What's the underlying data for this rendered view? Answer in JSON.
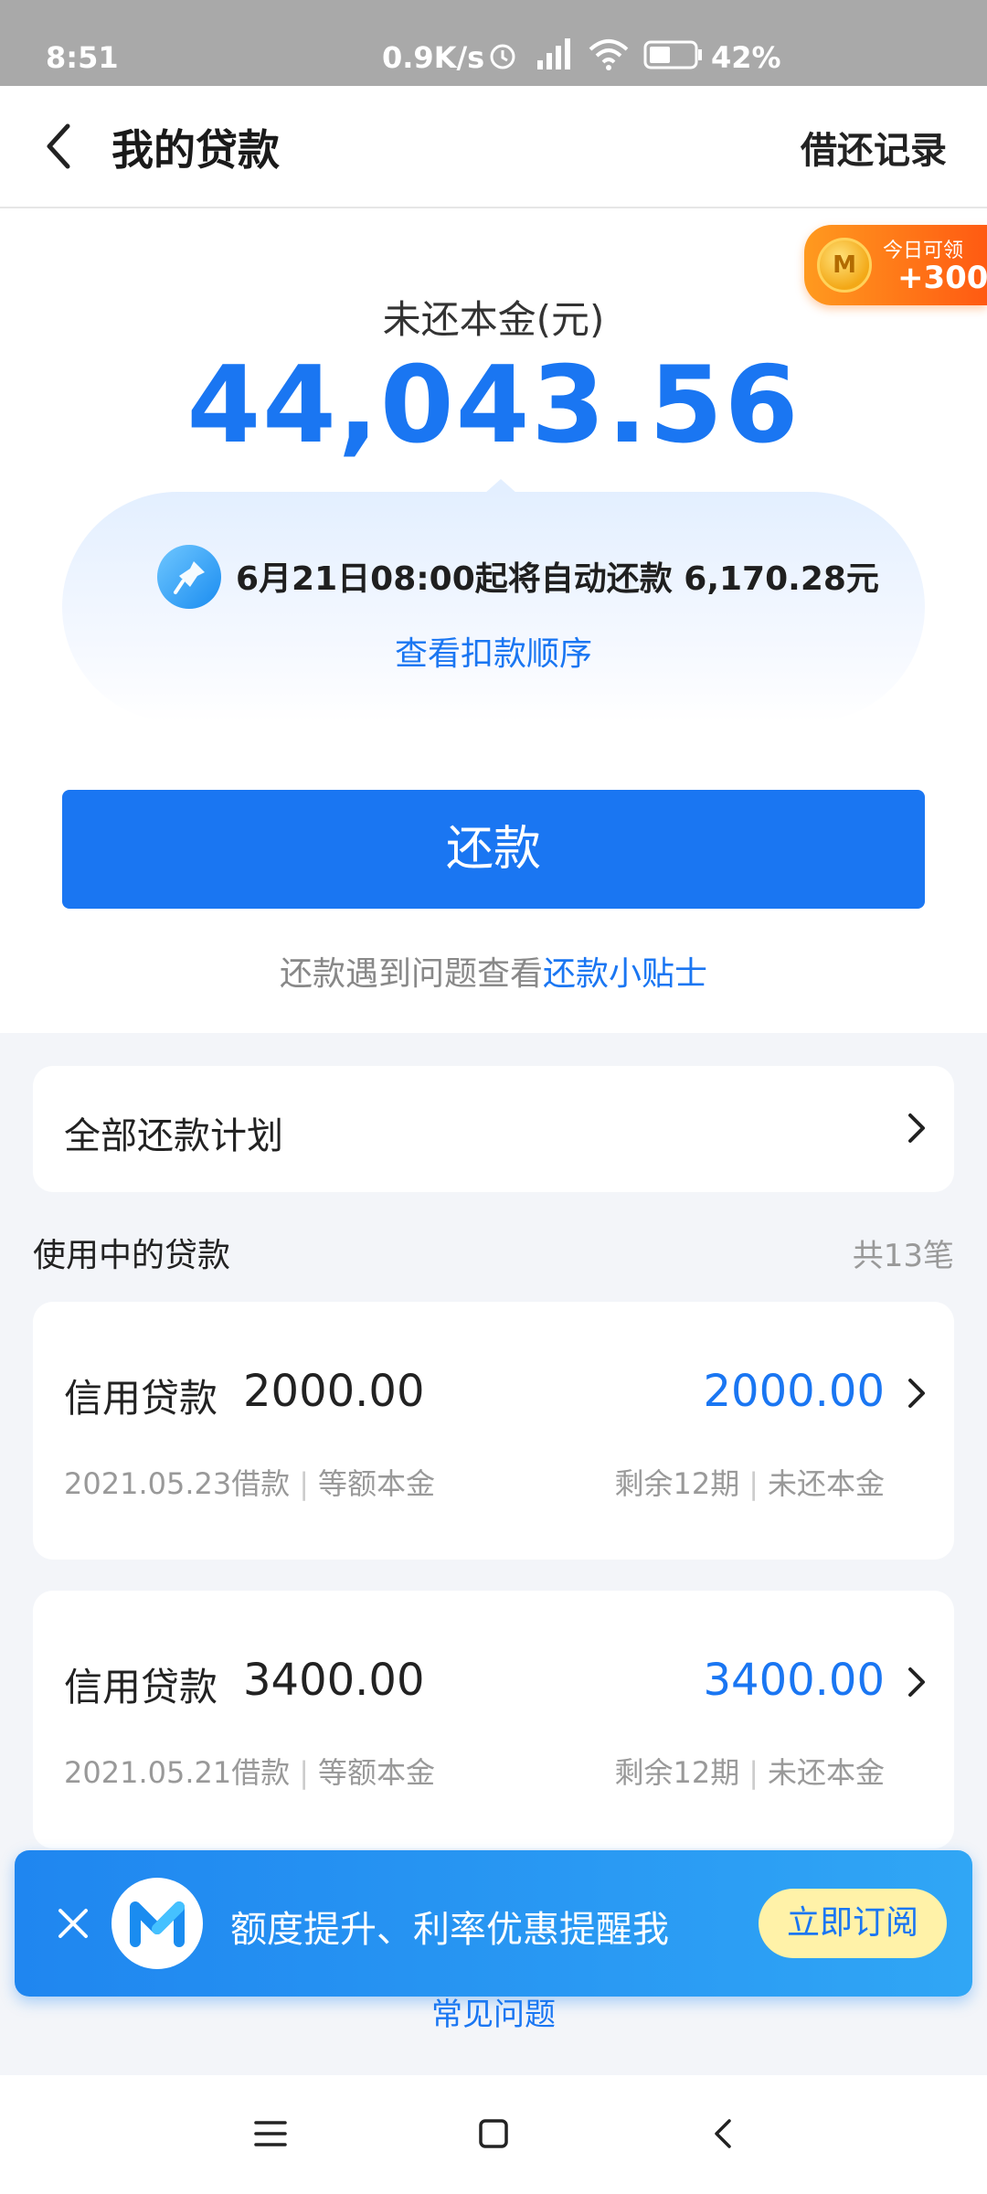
{
  "status_bar": {
    "time": "8:51",
    "net_speed": "0.9K/s",
    "battery": "42%"
  },
  "nav": {
    "title": "我的贷款",
    "right_action": "借还记录"
  },
  "badge": {
    "coin_letter": "M",
    "line1": "今日可领",
    "line2": "+300"
  },
  "summary": {
    "label": "未还本金(元)",
    "amount": "44,043.56"
  },
  "auto_repay": {
    "text": "6月21日08:00起将自动还款 6,170.28元",
    "link": "查看扣款顺序"
  },
  "repay_button": "还款",
  "tips": {
    "prefix": "还款遇到问题查看",
    "link": "还款小贴士"
  },
  "plan": {
    "label": "全部还款计划"
  },
  "active_loans": {
    "title": "使用中的贷款",
    "count": "共13笔",
    "items": [
      {
        "type": "信用贷款",
        "amount": "2000.00",
        "remaining": "2000.00",
        "date": "2021.05.23借款",
        "method": "等额本金",
        "periods": "剩余12期",
        "remaining_label": "未还本金"
      },
      {
        "type": "信用贷款",
        "amount": "3400.00",
        "remaining": "3400.00",
        "date": "2021.05.21借款",
        "method": "等额本金",
        "periods": "剩余12期",
        "remaining_label": "未还本金"
      }
    ]
  },
  "faq": "常见问题",
  "subscribe_banner": {
    "text": "额度提升、利率优惠提醒我",
    "button": "立即订阅"
  },
  "colors": {
    "accent": "#1a76f2",
    "badge": "#ff6a14",
    "button_bg": "#fff2a8"
  }
}
